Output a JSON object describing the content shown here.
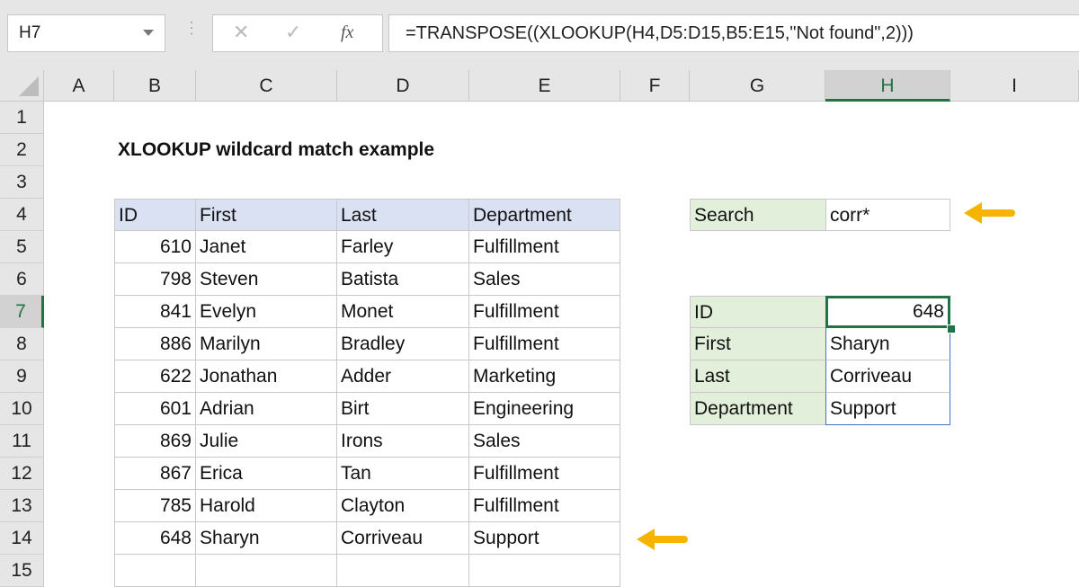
{
  "formula_bar": {
    "name_box": "H7",
    "cancel_icon": "✕",
    "enter_icon": "✓",
    "fx_label": "fx",
    "formula": "=TRANSPOSE((XLOOKUP(H4,D5:D15,B5:E15,\"Not found\",2)))"
  },
  "columns": [
    "A",
    "B",
    "C",
    "D",
    "E",
    "F",
    "G",
    "H",
    "I"
  ],
  "selected_column": "H",
  "rows": [
    "1",
    "2",
    "3",
    "4",
    "5",
    "6",
    "7",
    "8",
    "9",
    "10",
    "11",
    "12",
    "13",
    "14",
    "15"
  ],
  "selected_row": "7",
  "title": "XLOOKUP wildcard match example",
  "table": {
    "headers": [
      "ID",
      "First",
      "Last",
      "Department"
    ],
    "rows": [
      [
        "610",
        "Janet",
        "Farley",
        "Fulfillment"
      ],
      [
        "798",
        "Steven",
        "Batista",
        "Sales"
      ],
      [
        "841",
        "Evelyn",
        "Monet",
        "Fulfillment"
      ],
      [
        "886",
        "Marilyn",
        "Bradley",
        "Fulfillment"
      ],
      [
        "622",
        "Jonathan",
        "Adder",
        "Marketing"
      ],
      [
        "601",
        "Adrian",
        "Birt",
        "Engineering"
      ],
      [
        "869",
        "Julie",
        "Irons",
        "Sales"
      ],
      [
        "867",
        "Erica",
        "Tan",
        "Fulfillment"
      ],
      [
        "785",
        "Harold",
        "Clayton",
        "Fulfillment"
      ],
      [
        "648",
        "Sharyn",
        "Corriveau",
        "Support"
      ]
    ]
  },
  "search": {
    "label": "Search",
    "value": "corr*"
  },
  "result": {
    "labels": [
      "ID",
      "First",
      "Last",
      "Department"
    ],
    "values": [
      "648",
      "Sharyn",
      "Corriveau",
      "Support"
    ]
  },
  "colors": {
    "accent": "#217346",
    "arrow": "#f4b400",
    "header_blue": "#d9e1f2",
    "label_green": "#e2efda"
  }
}
